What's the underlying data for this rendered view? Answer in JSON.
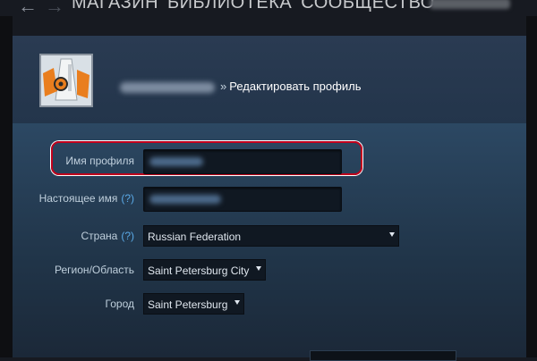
{
  "nav": {
    "back_icon": "arrow-left-icon",
    "forward_icon": "arrow-right-icon",
    "items": [
      "МАГАЗИН",
      "БИБЛИОТЕКА",
      "СООБЩЕСТВО"
    ]
  },
  "header": {
    "separator": "»",
    "breadcrumb_current": "Редактировать профиль"
  },
  "form": {
    "profile_name": {
      "label": "Имя профиля"
    },
    "real_name": {
      "label": "Настоящее имя",
      "help": "(?)"
    },
    "country": {
      "label": "Страна",
      "help": "(?)",
      "value": "Russian Federation"
    },
    "region": {
      "label": "Регион/Область",
      "value": "Saint Petersburg City"
    },
    "city": {
      "label": "Город",
      "value": "Saint Petersburg"
    }
  },
  "colors": {
    "highlight": "#c1001c",
    "help_link": "#5aa9e6",
    "background": "#1b2838"
  }
}
